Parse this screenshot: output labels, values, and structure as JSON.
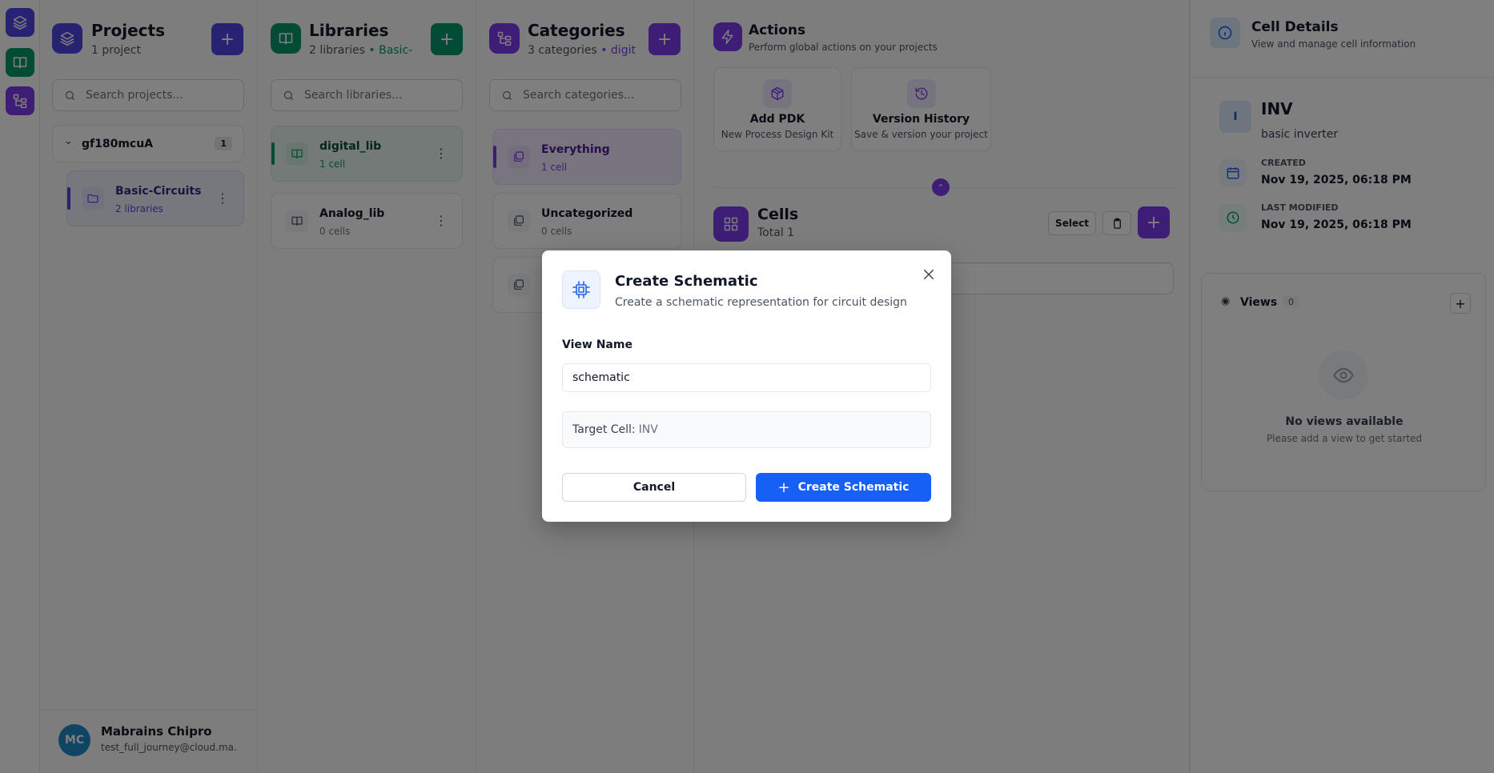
{
  "rail": {
    "items": [
      {
        "icon": "layers-icon",
        "color": "#4f46e5"
      },
      {
        "icon": "book-icon",
        "color": "#059669"
      },
      {
        "icon": "tree-icon",
        "color": "#7c3aed"
      }
    ]
  },
  "projects": {
    "title": "Projects",
    "subtitle": "1 project",
    "search_placeholder": "Search projects...",
    "group": {
      "name": "gf180mcuA",
      "count": "1"
    },
    "items": [
      {
        "name": "Basic-Circuits",
        "meta": "2 libraries"
      }
    ],
    "accent": "#4f46e5"
  },
  "libraries": {
    "title": "Libraries",
    "subtitle": "2 libraries",
    "subtitle_suffix": "• Basic-C...",
    "search_placeholder": "Search libraries...",
    "items": [
      {
        "name": "digital_lib",
        "meta": "1 cell"
      },
      {
        "name": "Analog_lib",
        "meta": "0 cells"
      }
    ],
    "accent": "#059669"
  },
  "categories": {
    "title": "Categories",
    "subtitle": "3 categories",
    "subtitle_suffix": "• digit...",
    "search_placeholder": "Search categories...",
    "items": [
      {
        "name": "Everything",
        "meta": "1 cell"
      },
      {
        "name": "Uncategorized",
        "meta": "0 cells"
      }
    ],
    "accent": "#7c3aed"
  },
  "actions": {
    "title": "Actions",
    "subtitle": "Perform global actions on your projects",
    "cards": [
      {
        "title": "Add PDK",
        "sub": "New Process Design Kit"
      },
      {
        "title": "Version History",
        "sub": "Save & version your project"
      }
    ]
  },
  "cells": {
    "title": "Cells",
    "subtitle": "Total 1",
    "select_label": "Select"
  },
  "cell_details": {
    "title": "Cell Details",
    "subtitle": "View and manage cell information",
    "avatar": "I",
    "name": "INV",
    "description": "basic inverter",
    "created_label": "CREATED",
    "created": "Nov 19, 2025, 06:18 PM",
    "modified_label": "LAST MODIFIED",
    "modified": "Nov 19, 2025, 06:18 PM",
    "views_label": "Views",
    "views_count": "0",
    "empty_title": "No views available",
    "empty_sub": "Please add a view to get started"
  },
  "user": {
    "initials": "MC",
    "name": "Mabrains Chipro",
    "email": "test_full_journey@cloud.ma..."
  },
  "modal": {
    "title": "Create Schematic",
    "subtitle": "Create a schematic representation for circuit design",
    "field_label": "View Name",
    "field_value": "schematic",
    "target_label": "Target Cell:",
    "target_value": "INV",
    "cancel_label": "Cancel",
    "create_label": "Create Schematic"
  }
}
